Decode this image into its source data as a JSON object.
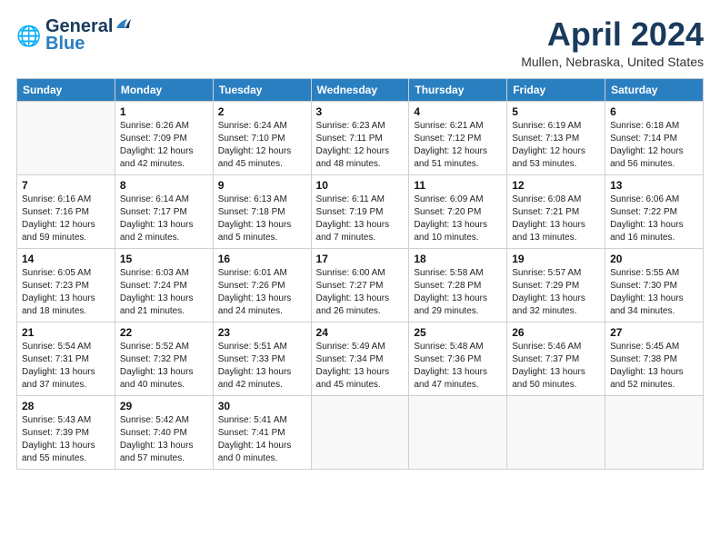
{
  "app": {
    "logo_line1": "General",
    "logo_line2": "Blue",
    "title": "April 2024",
    "subtitle": "Mullen, Nebraska, United States"
  },
  "calendar": {
    "headers": [
      "Sunday",
      "Monday",
      "Tuesday",
      "Wednesday",
      "Thursday",
      "Friday",
      "Saturday"
    ],
    "weeks": [
      [
        {
          "day": "",
          "info": ""
        },
        {
          "day": "1",
          "info": "Sunrise: 6:26 AM\nSunset: 7:09 PM\nDaylight: 12 hours\nand 42 minutes."
        },
        {
          "day": "2",
          "info": "Sunrise: 6:24 AM\nSunset: 7:10 PM\nDaylight: 12 hours\nand 45 minutes."
        },
        {
          "day": "3",
          "info": "Sunrise: 6:23 AM\nSunset: 7:11 PM\nDaylight: 12 hours\nand 48 minutes."
        },
        {
          "day": "4",
          "info": "Sunrise: 6:21 AM\nSunset: 7:12 PM\nDaylight: 12 hours\nand 51 minutes."
        },
        {
          "day": "5",
          "info": "Sunrise: 6:19 AM\nSunset: 7:13 PM\nDaylight: 12 hours\nand 53 minutes."
        },
        {
          "day": "6",
          "info": "Sunrise: 6:18 AM\nSunset: 7:14 PM\nDaylight: 12 hours\nand 56 minutes."
        }
      ],
      [
        {
          "day": "7",
          "info": "Sunrise: 6:16 AM\nSunset: 7:16 PM\nDaylight: 12 hours\nand 59 minutes."
        },
        {
          "day": "8",
          "info": "Sunrise: 6:14 AM\nSunset: 7:17 PM\nDaylight: 13 hours\nand 2 minutes."
        },
        {
          "day": "9",
          "info": "Sunrise: 6:13 AM\nSunset: 7:18 PM\nDaylight: 13 hours\nand 5 minutes."
        },
        {
          "day": "10",
          "info": "Sunrise: 6:11 AM\nSunset: 7:19 PM\nDaylight: 13 hours\nand 7 minutes."
        },
        {
          "day": "11",
          "info": "Sunrise: 6:09 AM\nSunset: 7:20 PM\nDaylight: 13 hours\nand 10 minutes."
        },
        {
          "day": "12",
          "info": "Sunrise: 6:08 AM\nSunset: 7:21 PM\nDaylight: 13 hours\nand 13 minutes."
        },
        {
          "day": "13",
          "info": "Sunrise: 6:06 AM\nSunset: 7:22 PM\nDaylight: 13 hours\nand 16 minutes."
        }
      ],
      [
        {
          "day": "14",
          "info": "Sunrise: 6:05 AM\nSunset: 7:23 PM\nDaylight: 13 hours\nand 18 minutes."
        },
        {
          "day": "15",
          "info": "Sunrise: 6:03 AM\nSunset: 7:24 PM\nDaylight: 13 hours\nand 21 minutes."
        },
        {
          "day": "16",
          "info": "Sunrise: 6:01 AM\nSunset: 7:26 PM\nDaylight: 13 hours\nand 24 minutes."
        },
        {
          "day": "17",
          "info": "Sunrise: 6:00 AM\nSunset: 7:27 PM\nDaylight: 13 hours\nand 26 minutes."
        },
        {
          "day": "18",
          "info": "Sunrise: 5:58 AM\nSunset: 7:28 PM\nDaylight: 13 hours\nand 29 minutes."
        },
        {
          "day": "19",
          "info": "Sunrise: 5:57 AM\nSunset: 7:29 PM\nDaylight: 13 hours\nand 32 minutes."
        },
        {
          "day": "20",
          "info": "Sunrise: 5:55 AM\nSunset: 7:30 PM\nDaylight: 13 hours\nand 34 minutes."
        }
      ],
      [
        {
          "day": "21",
          "info": "Sunrise: 5:54 AM\nSunset: 7:31 PM\nDaylight: 13 hours\nand 37 minutes."
        },
        {
          "day": "22",
          "info": "Sunrise: 5:52 AM\nSunset: 7:32 PM\nDaylight: 13 hours\nand 40 minutes."
        },
        {
          "day": "23",
          "info": "Sunrise: 5:51 AM\nSunset: 7:33 PM\nDaylight: 13 hours\nand 42 minutes."
        },
        {
          "day": "24",
          "info": "Sunrise: 5:49 AM\nSunset: 7:34 PM\nDaylight: 13 hours\nand 45 minutes."
        },
        {
          "day": "25",
          "info": "Sunrise: 5:48 AM\nSunset: 7:36 PM\nDaylight: 13 hours\nand 47 minutes."
        },
        {
          "day": "26",
          "info": "Sunrise: 5:46 AM\nSunset: 7:37 PM\nDaylight: 13 hours\nand 50 minutes."
        },
        {
          "day": "27",
          "info": "Sunrise: 5:45 AM\nSunset: 7:38 PM\nDaylight: 13 hours\nand 52 minutes."
        }
      ],
      [
        {
          "day": "28",
          "info": "Sunrise: 5:43 AM\nSunset: 7:39 PM\nDaylight: 13 hours\nand 55 minutes."
        },
        {
          "day": "29",
          "info": "Sunrise: 5:42 AM\nSunset: 7:40 PM\nDaylight: 13 hours\nand 57 minutes."
        },
        {
          "day": "30",
          "info": "Sunrise: 5:41 AM\nSunset: 7:41 PM\nDaylight: 14 hours\nand 0 minutes."
        },
        {
          "day": "",
          "info": ""
        },
        {
          "day": "",
          "info": ""
        },
        {
          "day": "",
          "info": ""
        },
        {
          "day": "",
          "info": ""
        }
      ]
    ]
  }
}
